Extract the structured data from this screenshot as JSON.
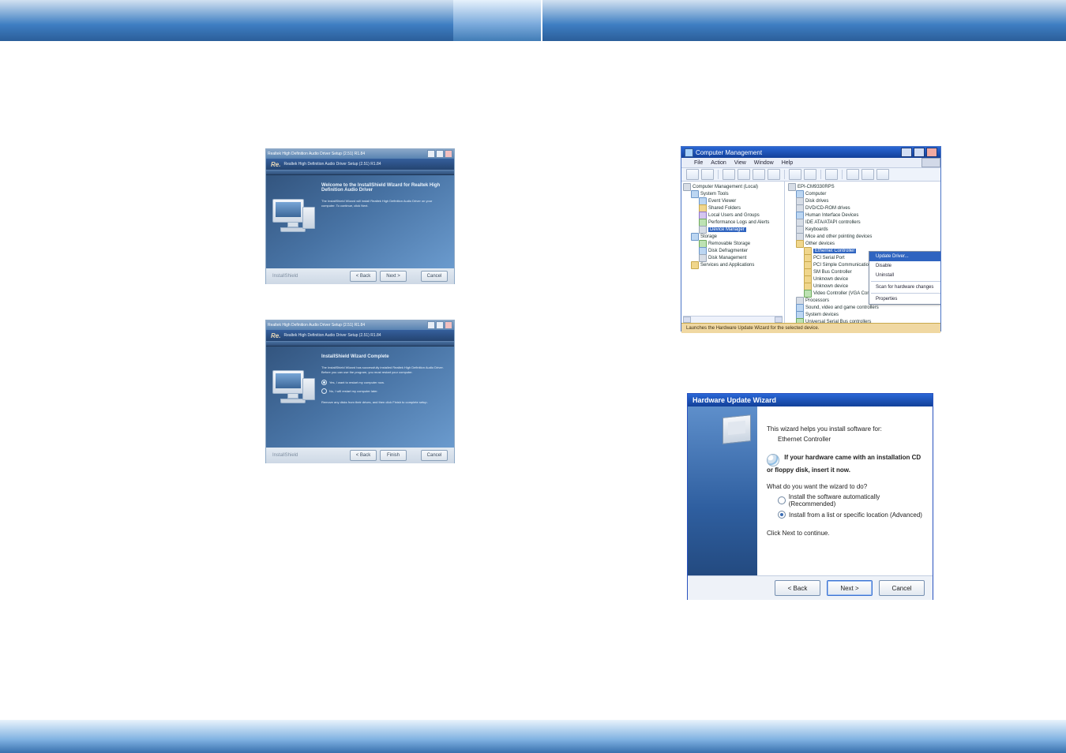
{
  "installer_top": {
    "window_title": "Realtek High Definition Audio Driver Setup (2.51) R1.84",
    "headline_prefix": "Re.",
    "headline": "Realtek High Definition Audio Driver Setup (2.51) R1.84",
    "heading": "Welcome to the InstallShield Wizard for Realtek High Definition Audio Driver",
    "para": "The InstallShield Wizard will install Realtek High Definition Audio Driver on your computer. To continue, click Next.",
    "install_label": "InstallShield",
    "btn_back": "< Back",
    "btn_next": "Next >",
    "btn_cancel": "Cancel"
  },
  "installer_bottom": {
    "window_title": "Realtek High Definition Audio Driver Setup (2.51) R1.84",
    "headline_prefix": "Re.",
    "headline": "Realtek High Definition Audio Driver Setup (2.51) R1.84",
    "heading": "InstallShield Wizard Complete",
    "para": "The InstallShield Wizard has successfully installed Realtek High Definition Audio Driver. Before you can use the program, you must restart your computer.",
    "opt1": "Yes, I want to restart my computer now.",
    "opt2": "No, I will restart my computer later.",
    "para2": "Remove any disks from their drives, and then click Finish to complete setup.",
    "install_label": "InstallShield",
    "btn_back": "< Back",
    "btn_finish": "Finish",
    "btn_cancel": "Cancel"
  },
  "cmg": {
    "window_title": "Computer Management",
    "menu": {
      "file": "File",
      "action": "Action",
      "view": "View",
      "window": "Window",
      "help": "Help"
    },
    "left_tree": {
      "root": "Computer Management (Local)",
      "n_system_tools": "System Tools",
      "n_event_viewer": "Event Viewer",
      "n_shared_folders": "Shared Folders",
      "n_local_users": "Local Users and Groups",
      "n_perf_logs": "Performance Logs and Alerts",
      "n_device_manager": "Device Manager",
      "n_storage": "Storage",
      "n_removable": "Removable Storage",
      "n_defrag": "Disk Defragmenter",
      "n_diskmgmt": "Disk Management",
      "n_services": "Services and Applications"
    },
    "right_tree": {
      "root": "EPI-CM9330RPS",
      "computer": "Computer",
      "disk_drives": "Disk drives",
      "dvd": "DVD/CD-ROM drives",
      "hid": "Human Interface Devices",
      "ide": "IDE ATA/ATAPI controllers",
      "keyboards": "Keyboards",
      "mice": "Mice and other pointing devices",
      "other": "Other devices",
      "ethernet": "Ethernet Controller",
      "pci_ser": "PCI Serial Port",
      "pci_sim": "PCI Simple Communications Controller",
      "sm_bus": "SM Bus Controller",
      "unknown1": "Unknown device",
      "unknown2": "Unknown device",
      "video": "Video Controller (VGA Compatible)",
      "processors": "Processors",
      "sound": "Sound, video and game controllers",
      "sysdev": "System devices",
      "usb": "Universal Serial Bus controllers"
    },
    "ctx_menu": {
      "update": "Update Driver...",
      "disable": "Disable",
      "uninstall": "Uninstall",
      "scan": "Scan for hardware changes",
      "properties": "Properties"
    },
    "status": "Launches the Hardware Update Wizard for the selected device."
  },
  "huw": {
    "title": "Hardware Update Wizard",
    "line1": "This wizard helps you install software for:",
    "device": "Ethernet Controller",
    "cd_line": "If your hardware came with an installation CD or floppy disk, insert it now.",
    "question": "What do you want the wizard to do?",
    "opt1": "Install the software automatically (Recommended)",
    "opt2": "Install from a list or specific location (Advanced)",
    "continue": "Click Next to continue.",
    "btn_back": "< Back",
    "btn_next": "Next >",
    "btn_cancel": "Cancel"
  }
}
